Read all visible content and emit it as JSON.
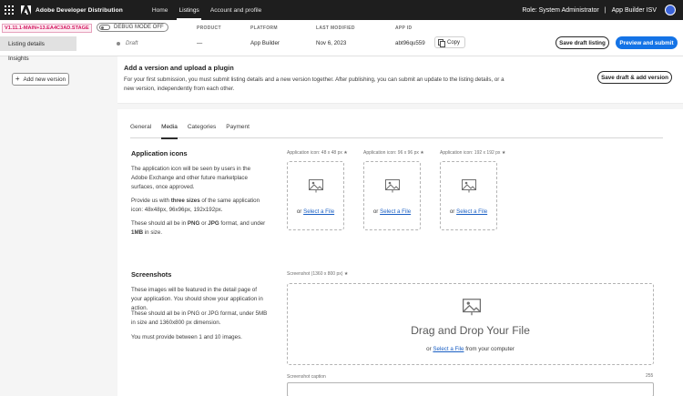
{
  "topbar": {
    "app_name": "Adobe Developer Distribution",
    "nav": [
      "Home",
      "Listings",
      "Account and profile"
    ],
    "active_nav": "Listings",
    "role_text": "Role: System Administrator",
    "org_text": "App Builder ISV",
    "separator": "|"
  },
  "status": {
    "env_badge": "V1.11.1-MAIN+13.EA4C3AD.STAGE",
    "debug_label": "DEBUG MODE OFF",
    "columns": {
      "product": {
        "label": "PRODUCT",
        "value": "—"
      },
      "platform": {
        "label": "PLATFORM",
        "value": "App Builder"
      },
      "last_modified": {
        "label": "LAST MODIFIED",
        "value": "Nov 6, 2023"
      },
      "app_id": {
        "label": "APP ID",
        "value": "abt96qu559"
      }
    },
    "status_value": "Draft",
    "copy_label": "Copy",
    "save_draft_label": "Save draft listing",
    "preview_submit_label": "Preview and submit"
  },
  "sidebar": {
    "items": [
      "Listing details",
      "Insights"
    ],
    "add_version_label": "Add new version"
  },
  "banner": {
    "title": "Add a version and upload a plugin",
    "text": "For your first submission, you must submit listing details and a new version together. After publishing, you can submit an update to the listing details, or a new version, independently from each other.",
    "button_label": "Save draft & add version"
  },
  "tabs": [
    "General",
    "Media",
    "Categories",
    "Payment"
  ],
  "active_tab": "Media",
  "app_icons": {
    "title": "Application icons",
    "p1": "The application icon will be seen by users in the Adobe Exchange and other future marketplace surfaces, once approved.",
    "p2_prefix": "Provide us with ",
    "p2_bold": "three sizes",
    "p2_suffix": " of the same application icon: 48x48px, 96x96px, 192x192px.",
    "p3_a": "These should all be in ",
    "p3_png": "PNG",
    "p3_b": " or ",
    "p3_jpg": "JPG",
    "p3_c": " format, and under ",
    "p3_size": "1MB",
    "p3_d": " in size.",
    "zones": [
      {
        "label": "Application icon: 48 x 48 px",
        "required": "★"
      },
      {
        "label": "Application icon: 96 x 96 px",
        "required": "★"
      },
      {
        "label": "Application icon: 192 x 192 px",
        "required": "★"
      }
    ],
    "or_text": "or",
    "select_file": "Select a File"
  },
  "screenshots": {
    "title": "Screenshots",
    "p1": "These images will be featured in the detail page of your application. You should show your application in action.",
    "p2": "These should all be in PNG or JPG format, under 5MB in size and 1360x800 px dimension.",
    "p3": "You must provide between 1 and 10 images.",
    "zone_label": "Screenshot (1360 x 800 px)",
    "required": "★",
    "drag_text": "Drag and Drop Your File",
    "or_text": "or",
    "select_file": "Select a File",
    "from_computer": "from your computer",
    "caption_label": "Screenshot caption",
    "caption_count": "255"
  },
  "colors": {
    "accent": "#1473e6",
    "topbar": "#1e1e1e",
    "env_badge": "#d3165f",
    "link": "#1a5fc4"
  }
}
